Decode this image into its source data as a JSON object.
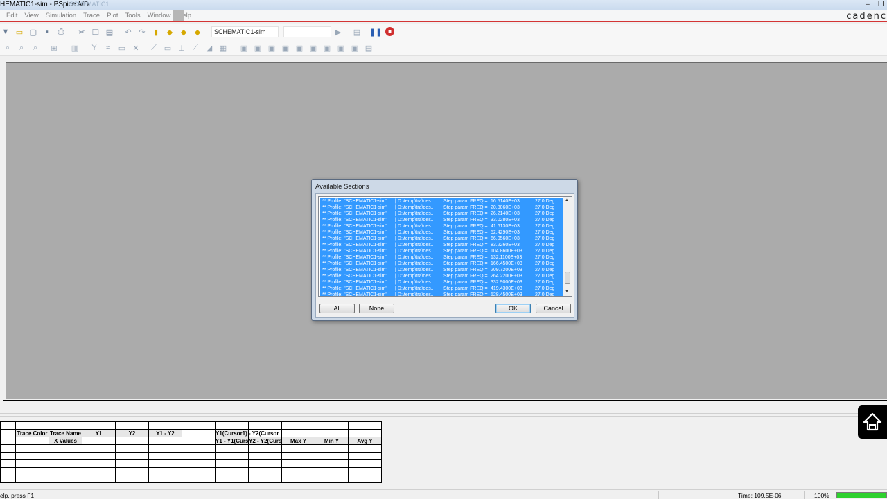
{
  "window": {
    "title": "HEMATIC1-sim - PSpice A/D",
    "ghost_title": "SCHEMATIC1",
    "logo": "cādenc"
  },
  "menu": [
    "Edit",
    "View",
    "Simulation",
    "Trace",
    "Plot",
    "Tools",
    "Window",
    "Help"
  ],
  "toolbar": {
    "profile": "SCHEMATIC1-sim",
    "second_select": ""
  },
  "dialog": {
    "title": "Available Sections",
    "rows": [
      {
        "profile": "** Profile: \"SCHEMATIC1-sim\"",
        "path": "[ D:\\temp\\tra\\des...",
        "step": "Step param FREQ =",
        "value": "16.5140E+03",
        "temp": "27.0 Deg"
      },
      {
        "profile": "** Profile: \"SCHEMATIC1-sim\"",
        "path": "[ D:\\temp\\tra\\des...",
        "step": "Step param FREQ =",
        "value": "20.8060E+03",
        "temp": "27.0 Deg"
      },
      {
        "profile": "** Profile: \"SCHEMATIC1-sim\"",
        "path": "[ D:\\temp\\tra\\des...",
        "step": "Step param FREQ =",
        "value": "26.2140E+03",
        "temp": "27.0 Deg"
      },
      {
        "profile": "** Profile: \"SCHEMATIC1-sim\"",
        "path": "[ D:\\temp\\tra\\des...",
        "step": "Step param FREQ =",
        "value": "33.0280E+03",
        "temp": "27.0 Deg"
      },
      {
        "profile": "** Profile: \"SCHEMATIC1-sim\"",
        "path": "[ D:\\temp\\tra\\des...",
        "step": "Step param FREQ =",
        "value": "41.6130E+03",
        "temp": "27.0 Deg"
      },
      {
        "profile": "** Profile: \"SCHEMATIC1-sim\"",
        "path": "[ D:\\temp\\tra\\des...",
        "step": "Step param FREQ =",
        "value": "52.4290E+03",
        "temp": "27.0 Deg"
      },
      {
        "profile": "** Profile: \"SCHEMATIC1-sim\"",
        "path": "[ D:\\temp\\tra\\des...",
        "step": "Step param FREQ =",
        "value": "66.0560E+03",
        "temp": "27.0 Deg"
      },
      {
        "profile": "** Profile: \"SCHEMATIC1-sim\"",
        "path": "[ D:\\temp\\tra\\des...",
        "step": "Step param FREQ =",
        "value": "83.2260E+03",
        "temp": "27.0 Deg"
      },
      {
        "profile": "** Profile: \"SCHEMATIC1-sim\"",
        "path": "[ D:\\temp\\tra\\des...",
        "step": "Step param FREQ =",
        "value": "104.8600E+03",
        "temp": "27.0 Deg"
      },
      {
        "profile": "** Profile: \"SCHEMATIC1-sim\"",
        "path": "[ D:\\temp\\tra\\des...",
        "step": "Step param FREQ =",
        "value": "132.1100E+03",
        "temp": "27.0 Deg"
      },
      {
        "profile": "** Profile: \"SCHEMATIC1-sim\"",
        "path": "[ D:\\temp\\tra\\des...",
        "step": "Step param FREQ =",
        "value": "166.4500E+03",
        "temp": "27.0 Deg"
      },
      {
        "profile": "** Profile: \"SCHEMATIC1-sim\"",
        "path": "[ D:\\temp\\tra\\des...",
        "step": "Step param FREQ =",
        "value": "209.7200E+03",
        "temp": "27.0 Deg"
      },
      {
        "profile": "** Profile: \"SCHEMATIC1-sim\"",
        "path": "[ D:\\temp\\tra\\des...",
        "step": "Step param FREQ =",
        "value": "264.2200E+03",
        "temp": "27.0 Deg"
      },
      {
        "profile": "** Profile: \"SCHEMATIC1-sim\"",
        "path": "[ D:\\temp\\tra\\des...",
        "step": "Step param FREQ =",
        "value": "332.9000E+03",
        "temp": "27.0 Deg"
      },
      {
        "profile": "** Profile: \"SCHEMATIC1-sim\"",
        "path": "[ D:\\temp\\tra\\des...",
        "step": "Step param FREQ =",
        "value": "419.4300E+03",
        "temp": "27.0 Deg"
      },
      {
        "profile": "** Profile: \"SCHEMATIC1-sim\"",
        "path": "[ D:\\temp\\tra\\des...",
        "step": "Step param FREQ =",
        "value": "528.4500E+03",
        "temp": "27.0 Deg"
      }
    ],
    "buttons": {
      "all": "All",
      "none": "None",
      "ok": "OK",
      "cancel": "Cancel"
    }
  },
  "cursor_table": {
    "header1": [
      "",
      "Trace Color",
      "Trace Name",
      "Y1",
      "Y2",
      "Y1 - Y2",
      "",
      "Y1(Cursor1) - Y2(Cursor",
      "",
      "",
      "",
      ""
    ],
    "header2": [
      "",
      "",
      "X Values",
      "",
      "",
      "",
      "",
      "Y1 - Y1(Curs",
      "Y2 - Y2(Curs",
      "Max Y",
      "Min Y",
      "Avg Y"
    ]
  },
  "status": {
    "left": "elp, press F1",
    "time": "Time: 109.5E-06",
    "zoom": "100%",
    "progress": 1.0
  },
  "colors": {
    "selection": "#3399ff",
    "canvas": "#ababab",
    "menu_accent": "#d43535",
    "progress": "#2ed12e"
  }
}
